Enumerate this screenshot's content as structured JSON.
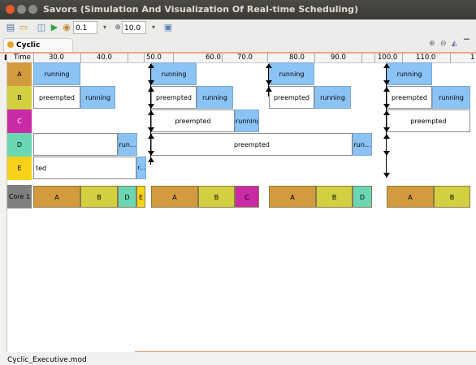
{
  "window": {
    "title": "Savors (Simulation And Visualization Of Real-time Scheduling)"
  },
  "toolbar": {
    "speed_value": "0.1",
    "zoom_value": "10.0"
  },
  "editor": {
    "tab_label": "Cyclic Executive"
  },
  "timeline": {
    "header_label": "Time",
    "ticks": [
      "30.0",
      "40.0",
      "50.0",
      "60.0",
      "70.0",
      "80.0",
      "90.0",
      "100.0",
      "110.0",
      "1"
    ]
  },
  "tasks": [
    {
      "label": "A",
      "color": "#d39b3e"
    },
    {
      "label": "B",
      "color": "#d2d040"
    },
    {
      "label": "C",
      "color": "#c92aa5"
    },
    {
      "label": "D",
      "color": "#6ad7b4"
    },
    {
      "label": "E",
      "color": "#f7d21b"
    }
  ],
  "task_blocks": {
    "A": [
      "running",
      "running",
      "running",
      "running"
    ],
    "B": [
      "preempted",
      "running",
      "preempted",
      "running",
      "preempted",
      "running",
      "preempted",
      "running"
    ],
    "C": [
      "preempted",
      "running",
      "preempted"
    ],
    "D": [
      "run...",
      "preempted",
      "run..."
    ],
    "E": [
      "ted",
      "r..."
    ]
  },
  "core": {
    "label": "Core 1",
    "color": "#808080",
    "blocks": [
      "A",
      "B",
      "D",
      "E",
      "A",
      "B",
      "C",
      "A",
      "B",
      "D",
      "A",
      "B"
    ]
  },
  "status": {
    "file": "Cyclic_Executive.mod"
  }
}
